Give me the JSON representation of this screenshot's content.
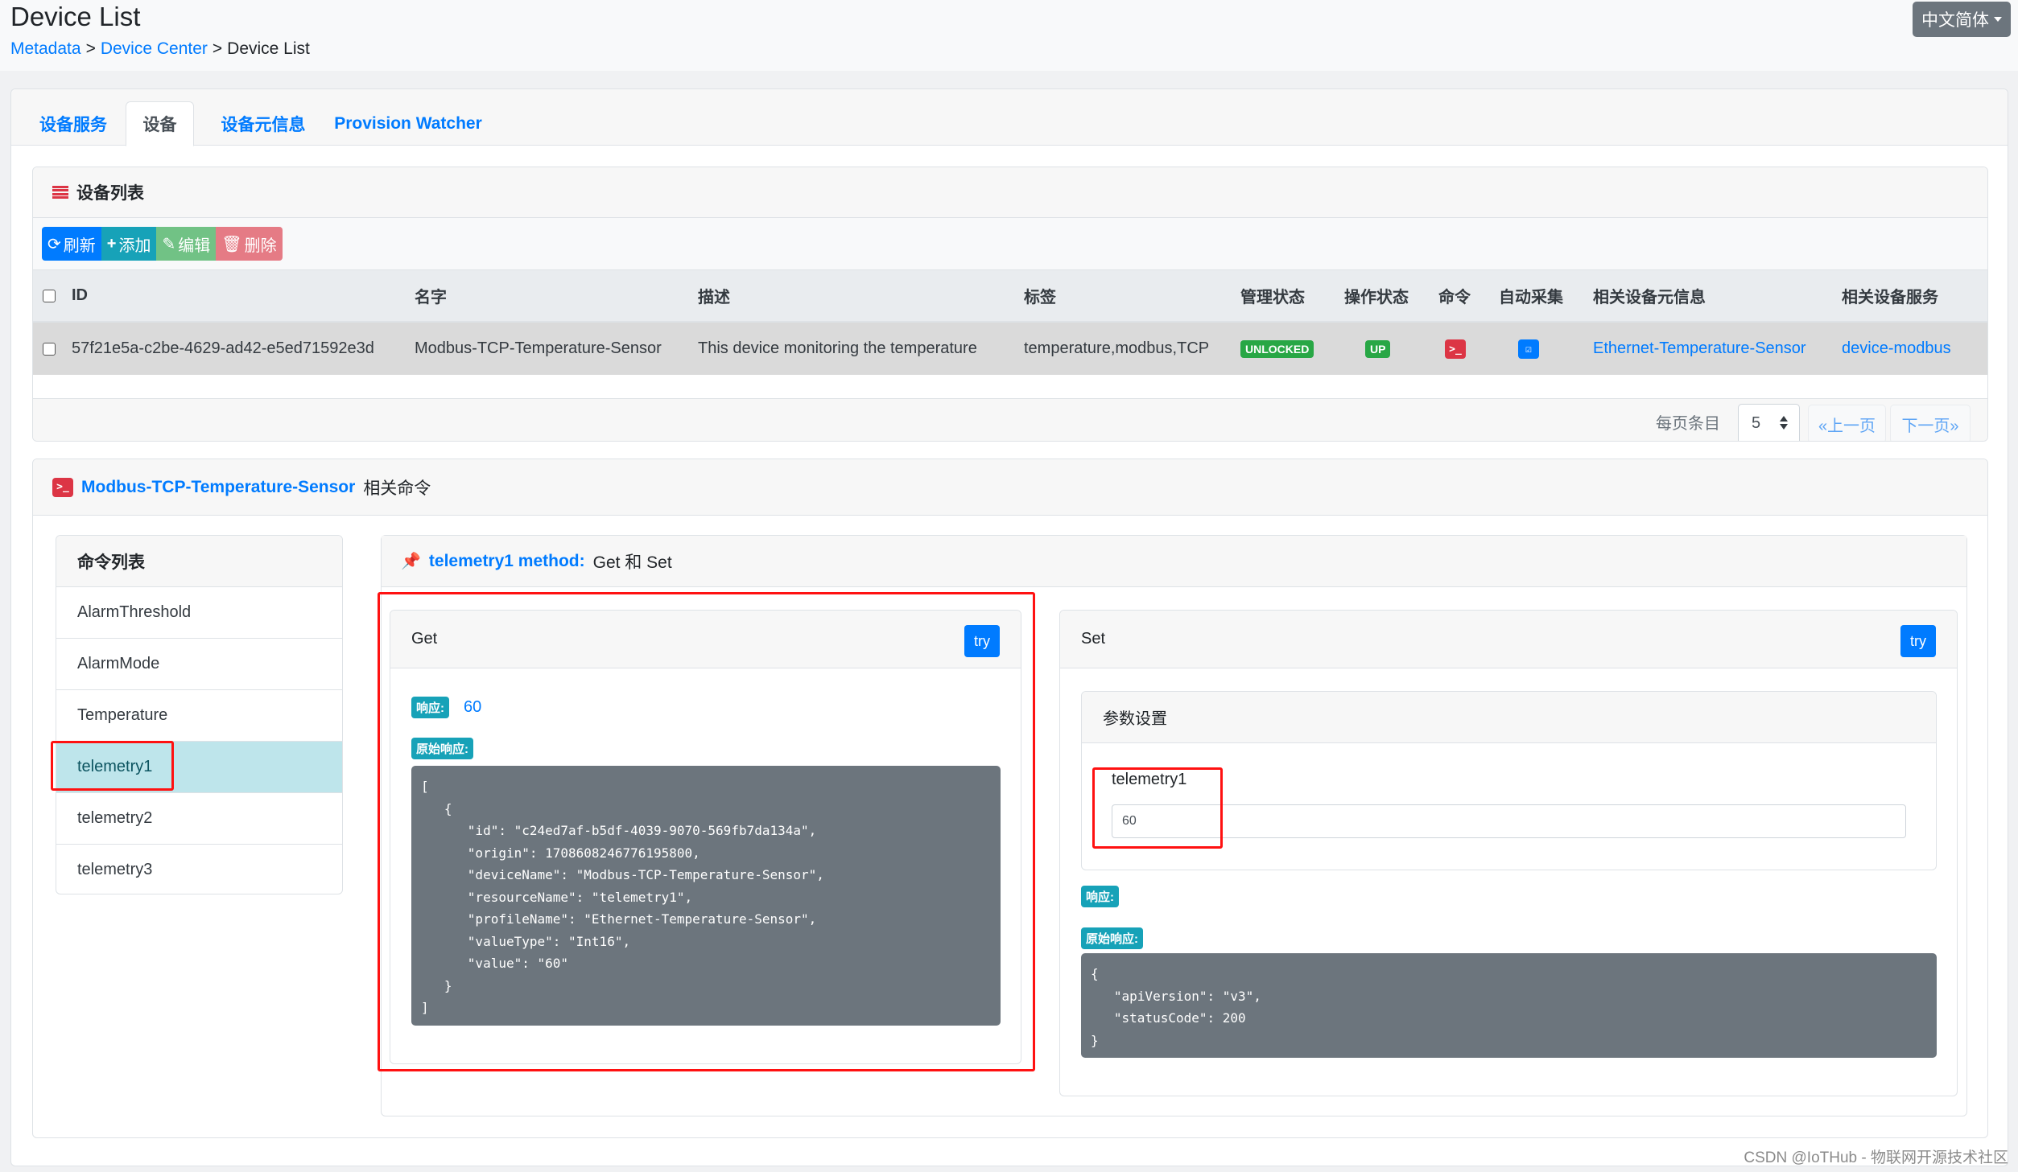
{
  "header": {
    "title": "Device List",
    "breadcrumb": [
      {
        "label": "Metadata",
        "link": true
      },
      {
        "label": "Device Center",
        "link": true
      },
      {
        "label": "Device List",
        "link": false
      }
    ],
    "separator": ">",
    "language": "中文简体"
  },
  "tabs": [
    {
      "label": "设备服务",
      "active": false
    },
    {
      "label": "设备",
      "active": true
    },
    {
      "label": "设备元信息",
      "active": false
    },
    {
      "label": "Provision Watcher",
      "active": false
    }
  ],
  "device_list": {
    "title": "设备列表",
    "toolbar": {
      "refresh": "刷新",
      "add": "添加",
      "edit": "编辑",
      "delete": "删除"
    },
    "columns": [
      "ID",
      "名字",
      "描述",
      "标签",
      "管理状态",
      "操作状态",
      "命令",
      "自动采集",
      "相关设备元信息",
      "相关设备服务"
    ],
    "rows": [
      {
        "id": "57f21e5a-c2be-4629-ad42-e5ed71592e3d",
        "name": "Modbus-TCP-Temperature-Sensor",
        "description": "This device monitoring the temperature",
        "labels": "temperature,modbus,TCP",
        "admin_state": "UNLOCKED",
        "operating_state": "UP",
        "command_icon": "terminal-icon",
        "autoevent_icon": "calendar-check-icon",
        "profile": "Ethernet-Temperature-Sensor",
        "service": "device-modbus"
      }
    ],
    "footer": {
      "per_page_label": "每页条目",
      "per_page_value": "5",
      "prev": "«上一页",
      "next": "下一页»"
    }
  },
  "commands": {
    "device_name": "Modbus-TCP-Temperature-Sensor",
    "title_suffix": "相关命令",
    "list_title": "命令列表",
    "items": [
      {
        "label": "AlarmThreshold",
        "active": false
      },
      {
        "label": "AlarmMode",
        "active": false
      },
      {
        "label": "Temperature",
        "active": false
      },
      {
        "label": "telemetry1",
        "active": true
      },
      {
        "label": "telemetry2",
        "active": false
      },
      {
        "label": "telemetry3",
        "active": false
      }
    ],
    "method": {
      "name": "telemetry1 method:",
      "methods": "Get 和 Set"
    },
    "get": {
      "title": "Get",
      "try": "try",
      "response_label": "响应:",
      "response_value": "60",
      "raw_label": "原始响应:",
      "raw": "[\n   {\n      \"id\": \"c24ed7af-b5df-4039-9070-569fb7da134a\",\n      \"origin\": 1708608246776195800,\n      \"deviceName\": \"Modbus-TCP-Temperature-Sensor\",\n      \"resourceName\": \"telemetry1\",\n      \"profileName\": \"Ethernet-Temperature-Sensor\",\n      \"valueType\": \"Int16\",\n      \"value\": \"60\"\n   }\n]"
    },
    "set": {
      "title": "Set",
      "try": "try",
      "param_title": "参数设置",
      "param_label": "telemetry1",
      "param_value": "60",
      "response_label": "响应:",
      "raw_label": "原始响应:",
      "raw": "{\n   \"apiVersion\": \"v3\",\n   \"statusCode\": 200\n}"
    }
  },
  "watermark": "CSDN @IoTHub - 物联网开源技术社区",
  "colors": {
    "primary": "#007bff",
    "success": "#28a745",
    "danger": "#dc3545",
    "info": "#17a2b8",
    "secondary": "#6c757d",
    "highlight": "#bee5eb",
    "annotation": "#ff1111"
  }
}
